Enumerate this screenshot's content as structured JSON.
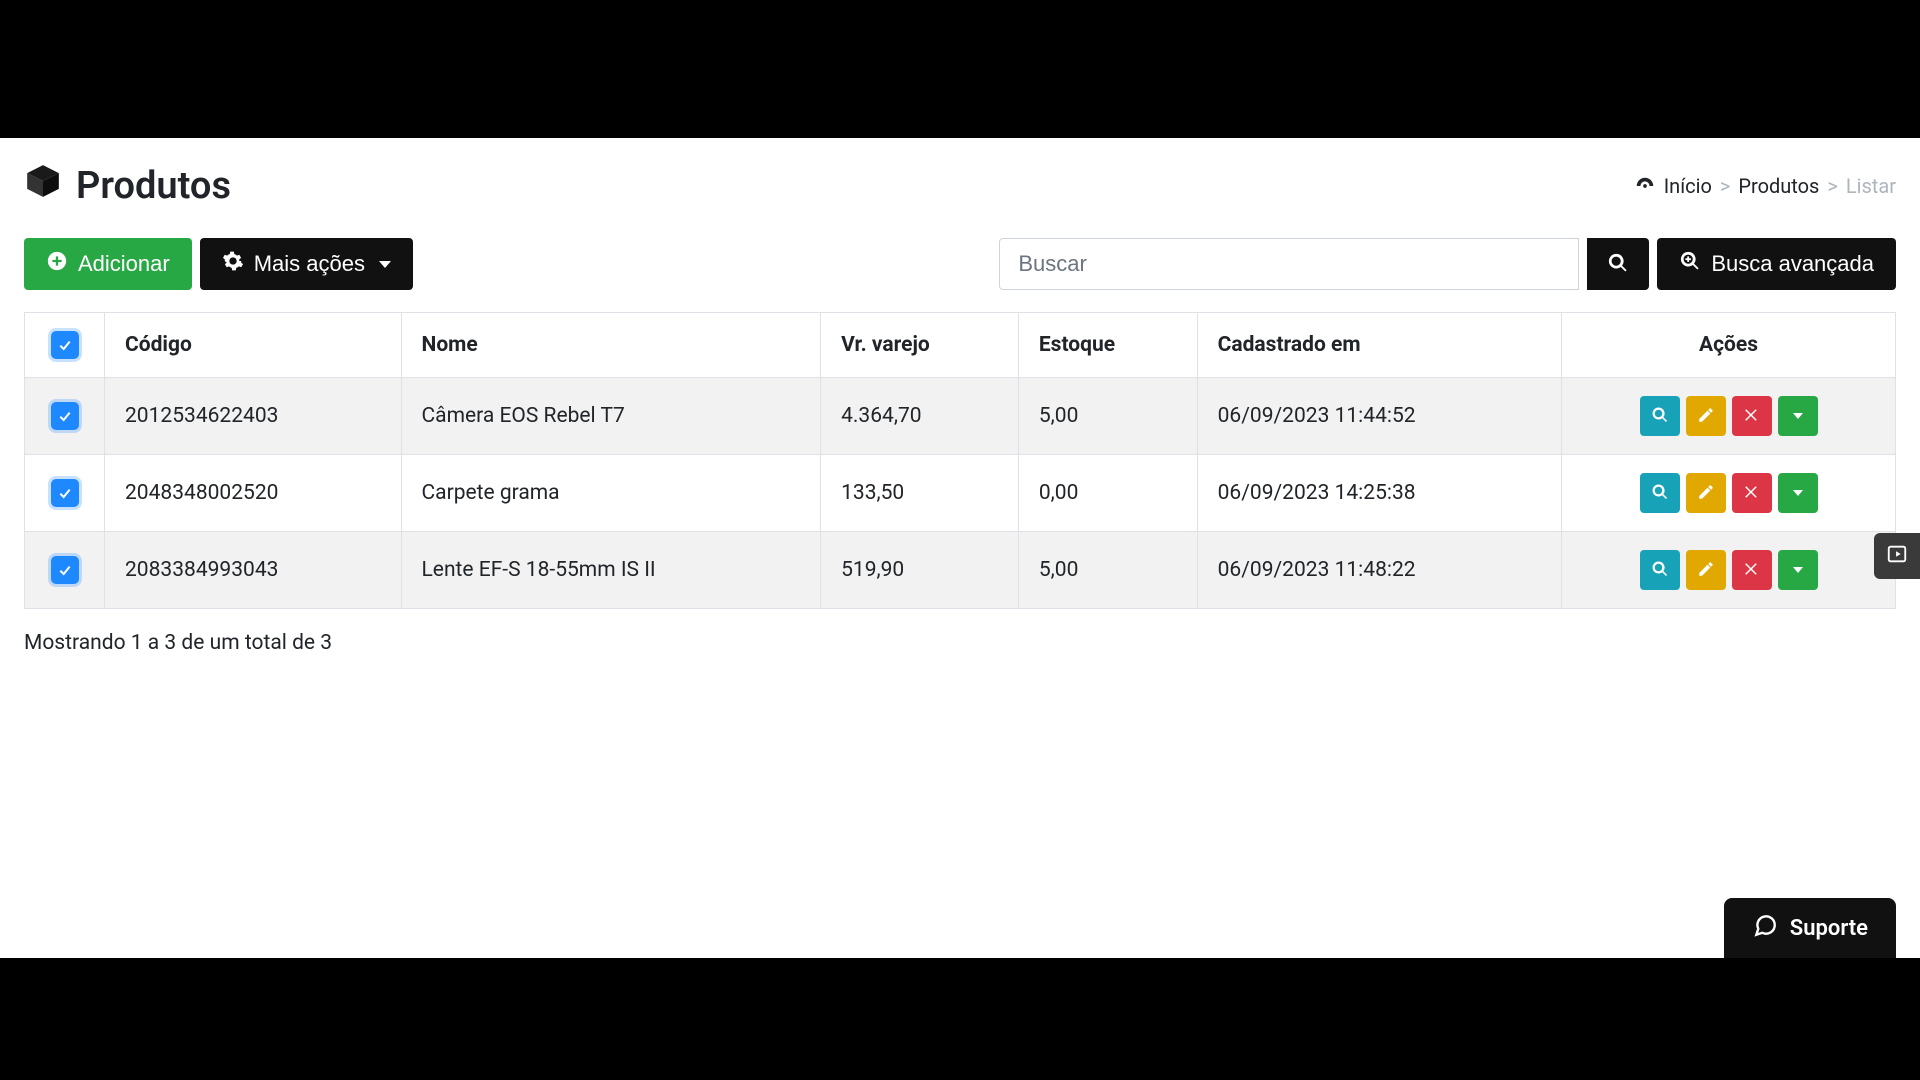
{
  "page": {
    "title": "Produtos"
  },
  "breadcrumb": {
    "home": "Início",
    "section": "Produtos",
    "current": "Listar"
  },
  "toolbar": {
    "add_label": "Adicionar",
    "more_actions_label": "Mais ações",
    "search_placeholder": "Buscar",
    "advanced_search_label": "Busca avançada"
  },
  "table": {
    "columns": {
      "code": "Código",
      "name": "Nome",
      "retail": "Vr. varejo",
      "stock": "Estoque",
      "created": "Cadastrado em",
      "actions": "Ações"
    },
    "rows": [
      {
        "code": "2012534622403",
        "name": "Câmera EOS Rebel T7",
        "retail": "4.364,70",
        "stock": "5,00",
        "created": "06/09/2023 11:44:52"
      },
      {
        "code": "2048348002520",
        "name": "Carpete grama",
        "retail": "133,50",
        "stock": "0,00",
        "created": "06/09/2023 14:25:38"
      },
      {
        "code": "2083384993043",
        "name": "Lente EF-S 18-55mm IS II",
        "retail": "519,90",
        "stock": "5,00",
        "created": "06/09/2023 11:48:22"
      }
    ]
  },
  "footer": {
    "showing": "Mostrando 1 a 3 de um total de 3"
  },
  "support": {
    "label": "Suporte"
  }
}
